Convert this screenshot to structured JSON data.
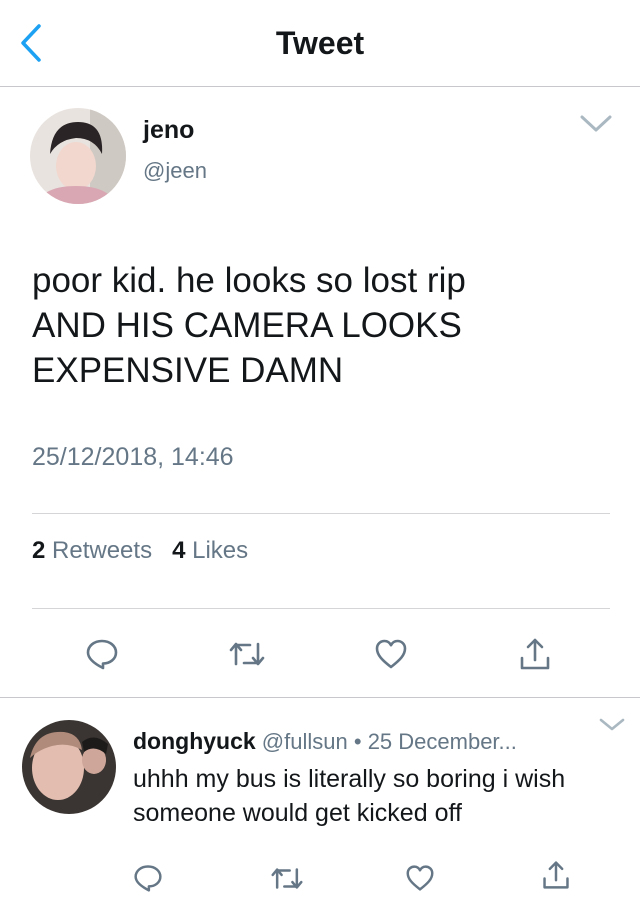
{
  "header": {
    "title": "Tweet",
    "back_icon": "chevron-left-icon"
  },
  "tweet": {
    "name": "jeno",
    "handle": "@jeen",
    "text": "poor kid. he looks so lost rip\nAND HIS CAMERA LOOKS\nEXPENSIVE DAMN",
    "timestamp": "25/12/2018, 14:46",
    "retweets_count": "2",
    "retweets_label": "Retweets",
    "likes_count": "4",
    "likes_label": "Likes",
    "actions": [
      "reply-icon",
      "retweet-icon",
      "heart-icon",
      "share-icon"
    ]
  },
  "reply": {
    "name": "donghyuck",
    "handle": "@fullsun",
    "separator": "•",
    "time": "25 December...",
    "text": "uhhh my bus is literally so boring i wish someone would get kicked off",
    "actions": [
      "reply-icon",
      "retweet-icon",
      "heart-icon",
      "share-icon"
    ]
  },
  "colors": {
    "accent": "#1da1f2",
    "secondary_text": "#657786",
    "primary_text": "#14171a",
    "divider": "#d5d5d8"
  }
}
